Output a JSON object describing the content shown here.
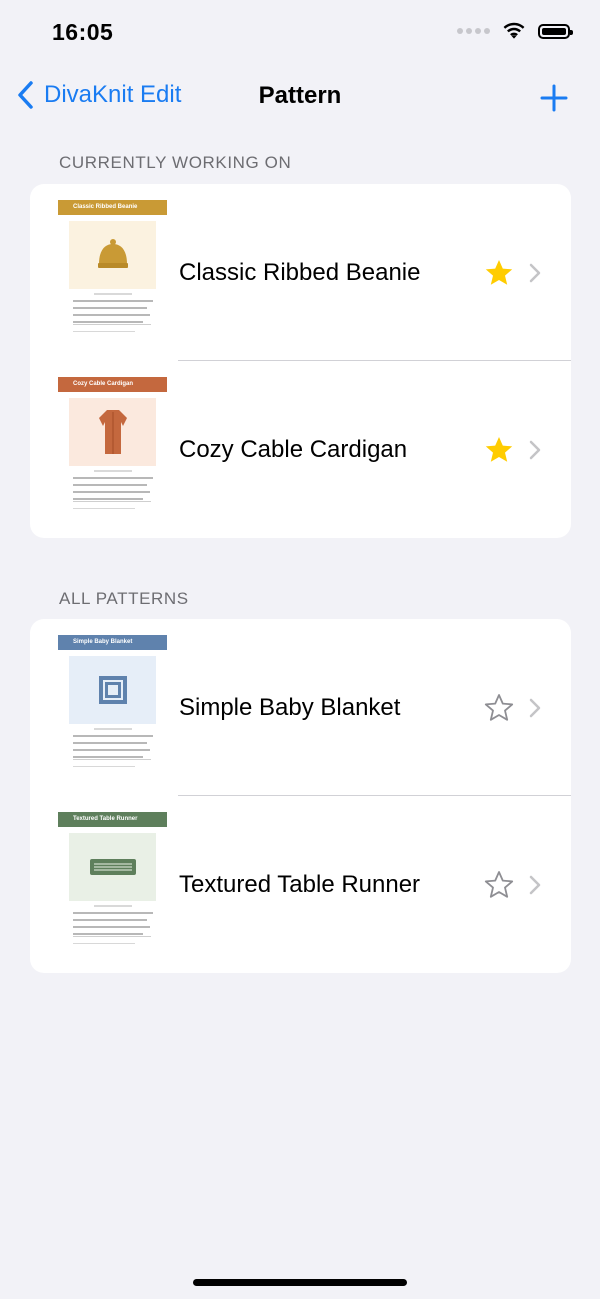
{
  "status_bar": {
    "time": "16:05"
  },
  "nav": {
    "back_label": "DivaKnit Edit",
    "title": "Pattern"
  },
  "sections": [
    {
      "header": "CURRENTLY WORKING ON",
      "rows": [
        {
          "title": "Classic Ribbed Beanie",
          "thumb_label": "Classic Ribbed Beanie",
          "banner_color": "#c99a35",
          "bg_color": "#fbf2e0",
          "favorite": true
        },
        {
          "title": "Cozy Cable Cardigan",
          "thumb_label": "Cozy Cable Cardigan",
          "banner_color": "#c4683e",
          "bg_color": "#fbe9de",
          "favorite": true
        }
      ]
    },
    {
      "header": "ALL PATTERNS",
      "rows": [
        {
          "title": "Simple Baby Blanket",
          "thumb_label": "Simple Baby Blanket",
          "banner_color": "#5f82ad",
          "bg_color": "#e6eef8",
          "favorite": false
        },
        {
          "title": "Textured Table Runner",
          "thumb_label": "Textured Table Runner",
          "banner_color": "#5e7f5c",
          "bg_color": "#e9f0e6",
          "favorite": false
        }
      ]
    }
  ],
  "colors": {
    "accent": "#1a7cf2",
    "star_filled": "#ffcc00",
    "star_outline": "#8e8e93",
    "chevron": "#c4c4c7"
  },
  "icons": [
    "wifi-icon",
    "battery-icon",
    "chevron-left-icon",
    "plus-icon",
    "star-filled-icon",
    "star-outline-icon",
    "chevron-right-icon"
  ]
}
